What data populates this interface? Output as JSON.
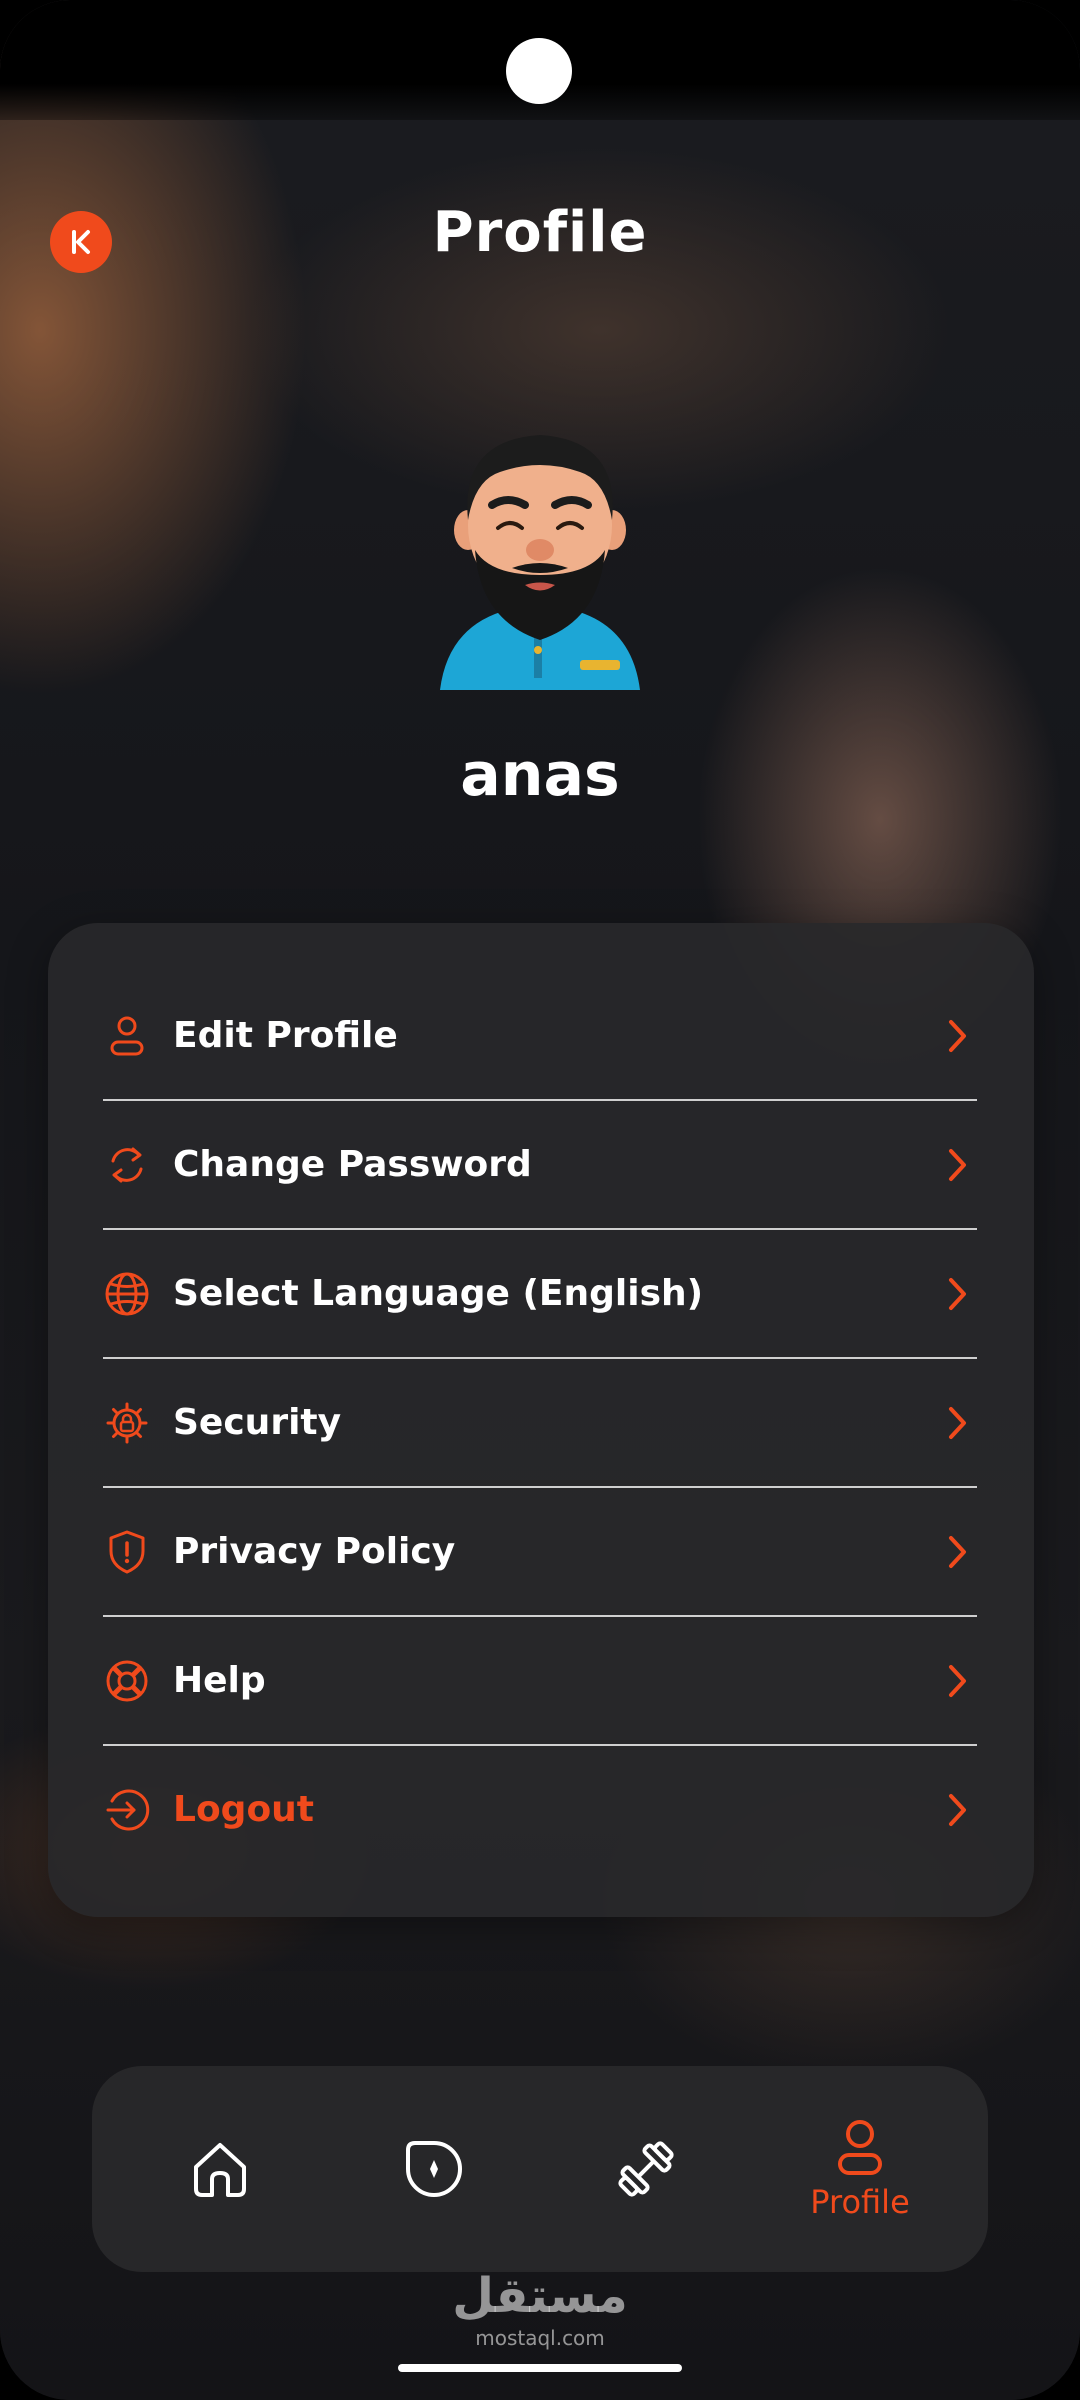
{
  "header": {
    "title": "Profile"
  },
  "profile": {
    "username": "anas"
  },
  "menu": {
    "items": [
      {
        "label": "Edit Profile",
        "icon": "user-icon"
      },
      {
        "label": "Change Password",
        "icon": "refresh-icon"
      },
      {
        "label": "Select Language (English)",
        "icon": "globe-icon"
      },
      {
        "label": "Security",
        "icon": "security-gear-icon"
      },
      {
        "label": "Privacy Policy",
        "icon": "shield-icon"
      },
      {
        "label": "Help",
        "icon": "lifebuoy-icon"
      },
      {
        "label": "Logout",
        "icon": "logout-icon"
      }
    ]
  },
  "nav": {
    "items": [
      {
        "icon": "home-icon",
        "label": ""
      },
      {
        "icon": "discover-icon",
        "label": ""
      },
      {
        "icon": "dumbbell-icon",
        "label": ""
      },
      {
        "icon": "profile-icon",
        "label": "Profile"
      }
    ],
    "active": "Profile"
  },
  "watermark": {
    "arabic": "مستقل",
    "latin": "mostaql.com"
  },
  "colors": {
    "accent": "#f04a1c",
    "card": "#28282a",
    "text": "#ffffff"
  }
}
